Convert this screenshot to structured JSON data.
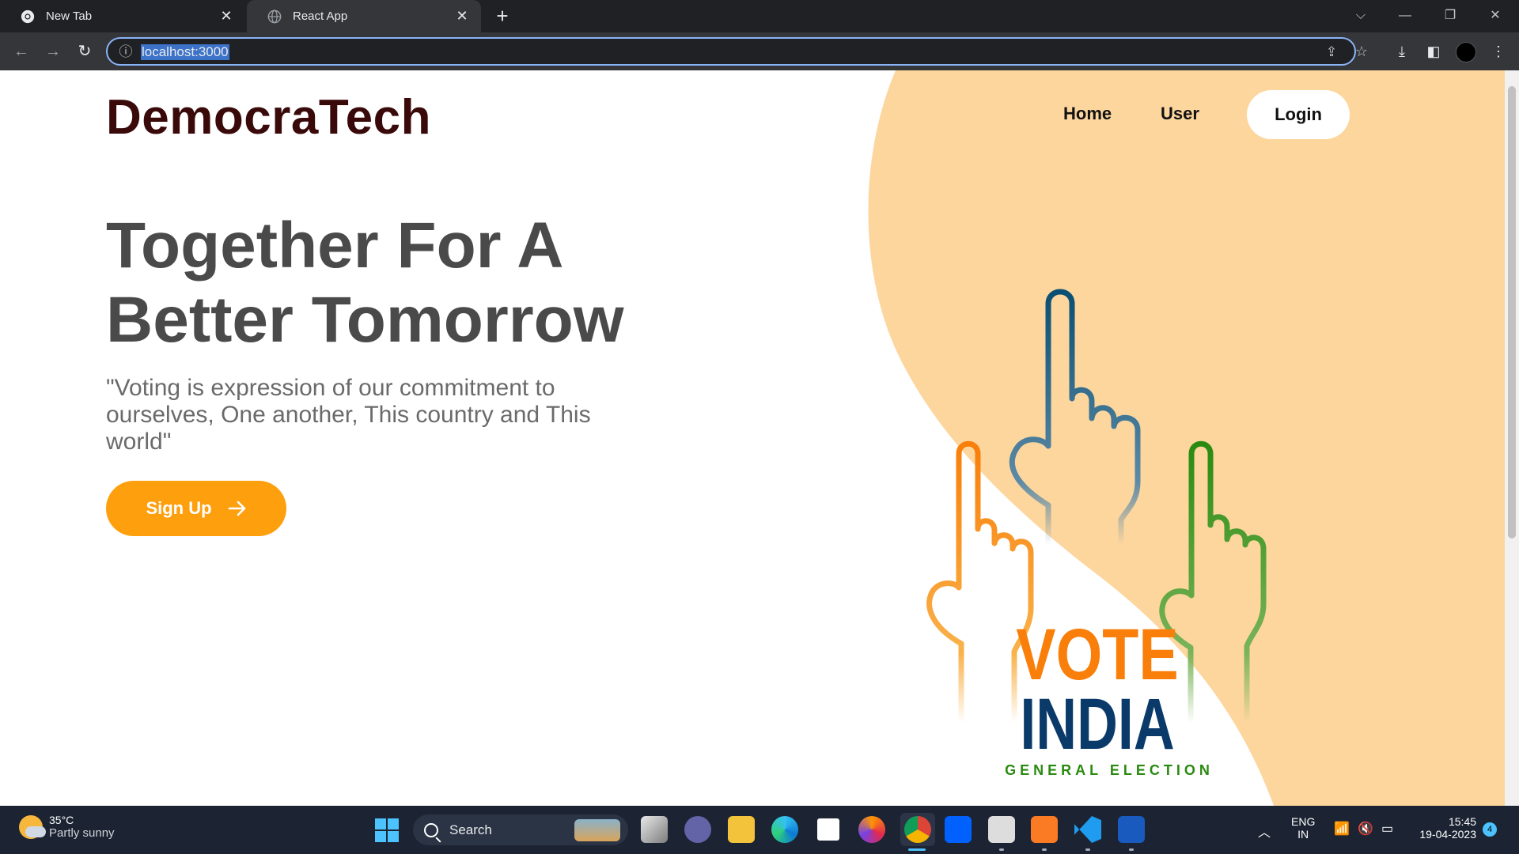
{
  "browser": {
    "tabs": [
      {
        "title": "New Tab",
        "active": false
      },
      {
        "title": "React App",
        "active": true
      }
    ],
    "url": "localhost:3000"
  },
  "page": {
    "brand": "DemocraTech",
    "nav": {
      "home": "Home",
      "user": "User",
      "login": "Login"
    },
    "headline": "Together For A Better Tomorrow",
    "quote": "\"Voting is expression of our commitment to ourselves, One another, This country and This world\"",
    "signup_label": "Sign Up",
    "art": {
      "vote": "VOTE",
      "india": "INDIA",
      "subtitle": "GENERAL ELECTION"
    },
    "colors": {
      "blob": "#fdd69e",
      "signup": "#fe9f0e",
      "brand": "#3a0a0a",
      "saffron": "#f97e0a",
      "navy": "#0a4f73",
      "green": "#2a8a10"
    }
  },
  "taskbar": {
    "weather_temp": "35°C",
    "weather_desc": "Partly sunny",
    "search_label": "Search",
    "lang_top": "ENG",
    "lang_bottom": "IN",
    "time": "15:45",
    "date": "19-04-2023",
    "notification_count": "4"
  }
}
